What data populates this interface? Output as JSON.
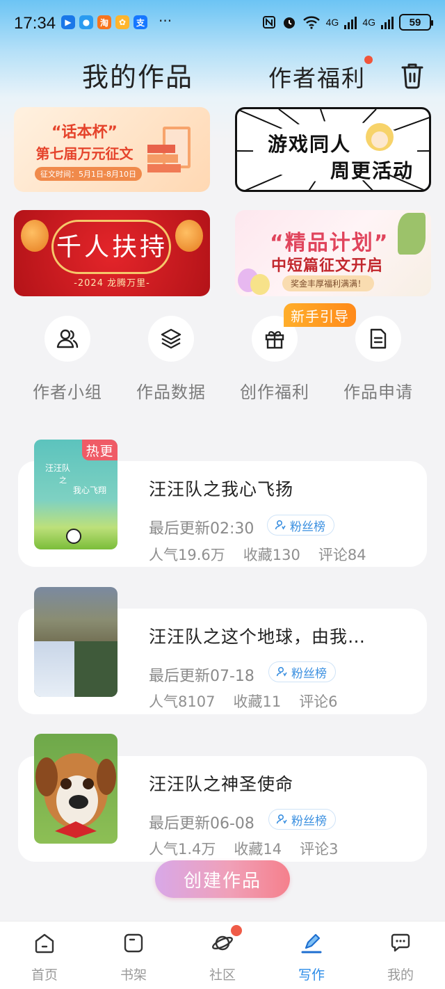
{
  "status_bar": {
    "time": "17:34",
    "app_icons": [
      {
        "name": "bilibili-like-app-icon",
        "glyph": "▶",
        "color": "#1a77e8"
      },
      {
        "name": "message-app-icon",
        "glyph": "●",
        "color": "#2a9bf0"
      },
      {
        "name": "taobao-icon",
        "glyph": "淘",
        "color": "#f7741d"
      },
      {
        "name": "shopping-app-icon",
        "glyph": "✿",
        "color": "#ffb52e"
      },
      {
        "name": "alipay-icon",
        "glyph": "支",
        "color": "#1677ff"
      }
    ],
    "more": "···",
    "net_1": "4G",
    "net_2": "4G",
    "battery": "59"
  },
  "header": {
    "title": "我的作品",
    "welfare": "作者福利"
  },
  "banners": {
    "b1": {
      "line1": "“话本杯”",
      "line2": "第七届万元征文",
      "date": "征文时间：5月1日-8月10日"
    },
    "b2": {
      "line1": "游戏同人",
      "line2": "周更活动"
    },
    "b3": {
      "title": "千人扶持",
      "sub": "-2024 龙腾万里-"
    },
    "b4": {
      "title": "“精品计划”",
      "sub": "中短篇征文开启",
      "tag": "奖金丰厚福利满满！"
    }
  },
  "actions": [
    {
      "label": "作者小组",
      "icon": "users-icon"
    },
    {
      "label": "作品数据",
      "icon": "layers-icon"
    },
    {
      "label": "创作福利",
      "icon": "gift-icon"
    },
    {
      "label": "作品申请",
      "icon": "document-icon"
    }
  ],
  "new_badge": "新手引导",
  "works": [
    {
      "title": "汪汪队之我心飞扬",
      "update": "最后更新02:30",
      "fan": "粉丝榜",
      "popularity": "人气19.6万",
      "favorites": "收藏130",
      "comments": "评论84",
      "tag": "热更",
      "cover_text": [
        "汪汪队",
        "之",
        "我心飞翔"
      ]
    },
    {
      "title": "汪汪队之这个地球，由我…",
      "update": "最后更新07-18",
      "fan": "粉丝榜",
      "popularity": "人气8107",
      "favorites": "收藏11",
      "comments": "评论6"
    },
    {
      "title": "汪汪队之神圣使命",
      "update": "最后更新06-08",
      "fan": "粉丝榜",
      "popularity": "人气1.4万",
      "favorites": "收藏14",
      "comments": "评论3"
    }
  ],
  "create_button": "创建作品",
  "nav": [
    {
      "label": "首页",
      "icon": "home-icon"
    },
    {
      "label": "书架",
      "icon": "bookshelf-icon"
    },
    {
      "label": "社区",
      "icon": "planet-icon"
    },
    {
      "label": "写作",
      "icon": "pen-icon",
      "active": true
    },
    {
      "label": "我的",
      "icon": "chat-bubble-icon"
    }
  ],
  "colors": {
    "accent": "#2a8be8",
    "hot": "#ef5b66",
    "badge": "#ff9a22"
  }
}
